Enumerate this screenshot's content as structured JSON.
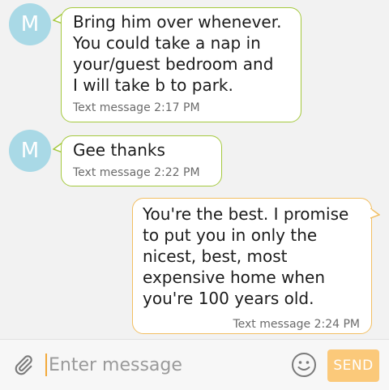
{
  "messages": [
    {
      "direction": "incoming",
      "avatar_letter": "M",
      "text": "Bring him over whenever.\nYou could take a nap in\nyour/guest bedroom and\nI will take b to park.",
      "meta": "Text message 2:17 PM"
    },
    {
      "direction": "incoming",
      "avatar_letter": "M",
      "text": "Gee thanks",
      "meta": "Text message 2:22 PM"
    },
    {
      "direction": "outgoing",
      "text": "You're the best. I promise\nto put you in only the\nnicest, best, most\nexpensive home when\nyou're 100 years old.",
      "meta": "Text message 2:24 PM"
    }
  ],
  "composer": {
    "placeholder": "Enter message",
    "value": "",
    "send_label": "SEND",
    "attach_icon": "paperclip-icon",
    "emoji_icon": "smiley-icon"
  },
  "colors": {
    "avatar": "#a9d9e6",
    "incoming_border": "#a5c93e",
    "outgoing_border": "#f2bf62",
    "send_button": "#fbc97a",
    "caret": "#f2a93b"
  }
}
